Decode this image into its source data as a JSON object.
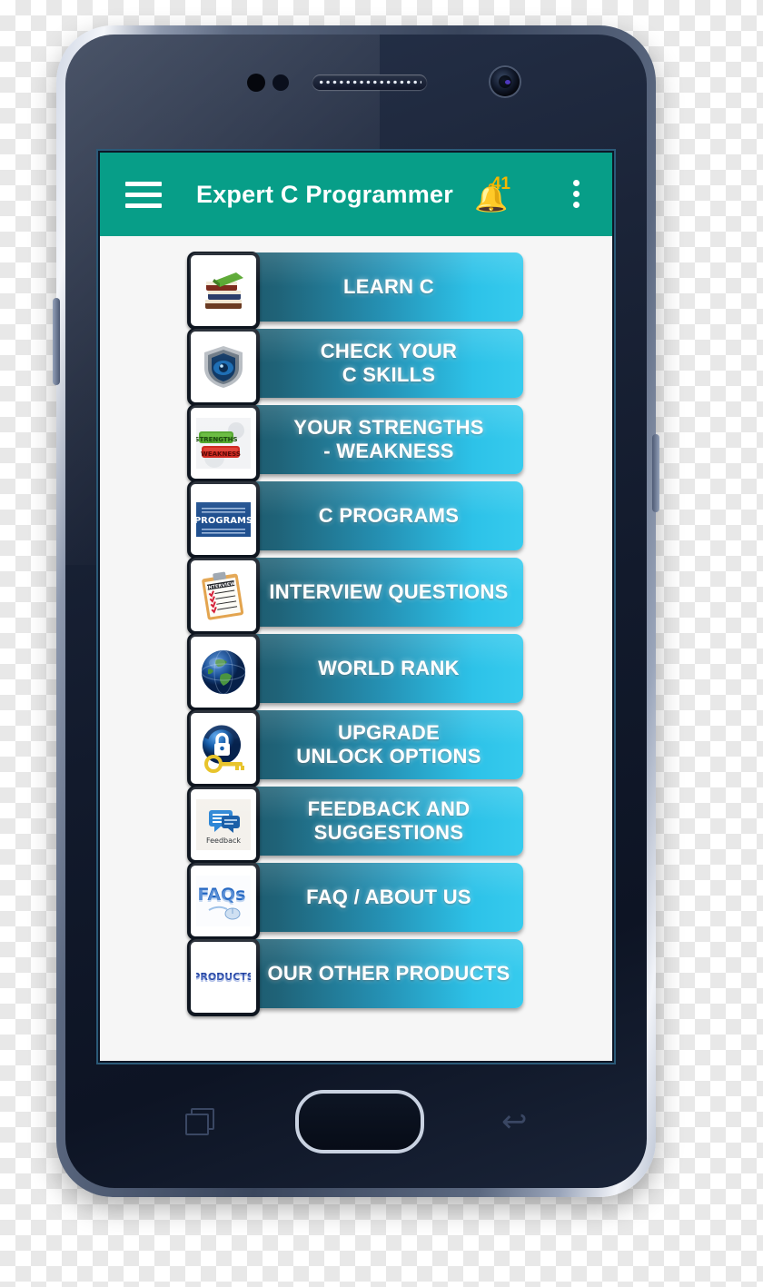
{
  "app": {
    "title": "Expert C Programmer",
    "accent_color": "#079e88",
    "screen_bg": "#f6f6f6",
    "appbar": {
      "menu_icon": "hamburger-menu-icon",
      "notification_icon": "bell-icon",
      "notification_count": "41",
      "notification_badge_color": "#f5b700",
      "overflow_icon": "more-vertical-icon"
    }
  },
  "menu": {
    "gradient_from": "#1b4d5e",
    "gradient_to": "#36cbee",
    "items": [
      {
        "label": "LEARN C",
        "icon": "books-stack-icon"
      },
      {
        "label": "CHECK YOUR\nC SKILLS",
        "icon": "shield-icon"
      },
      {
        "label": "YOUR STRENGTHS\n- WEAKNESS",
        "icon": "strength-weakness-labels-icon"
      },
      {
        "label": "C PROGRAMS",
        "icon": "programs-book-icon"
      },
      {
        "label": "INTERVIEW QUESTIONS",
        "icon": "interview-clipboard-icon"
      },
      {
        "label": "WORLD RANK",
        "icon": "globe-icon"
      },
      {
        "label": "UPGRADE\nUNLOCK OPTIONS",
        "icon": "lock-key-icon"
      },
      {
        "label": "FEEDBACK AND\nSUGGESTIONS",
        "icon": "feedback-chat-icon"
      },
      {
        "label": "FAQ / ABOUT US",
        "icon": "faqs-icon"
      },
      {
        "label": "OUR OTHER PRODUCTS",
        "icon": "products-icon"
      }
    ]
  },
  "device": {
    "home_button": "home-button",
    "recents_button": "recents-button",
    "back_button": "back-button",
    "volume_key": "volume-key",
    "power_key": "power-key",
    "earpiece": "earpiece-speaker",
    "front_camera": "front-camera"
  }
}
